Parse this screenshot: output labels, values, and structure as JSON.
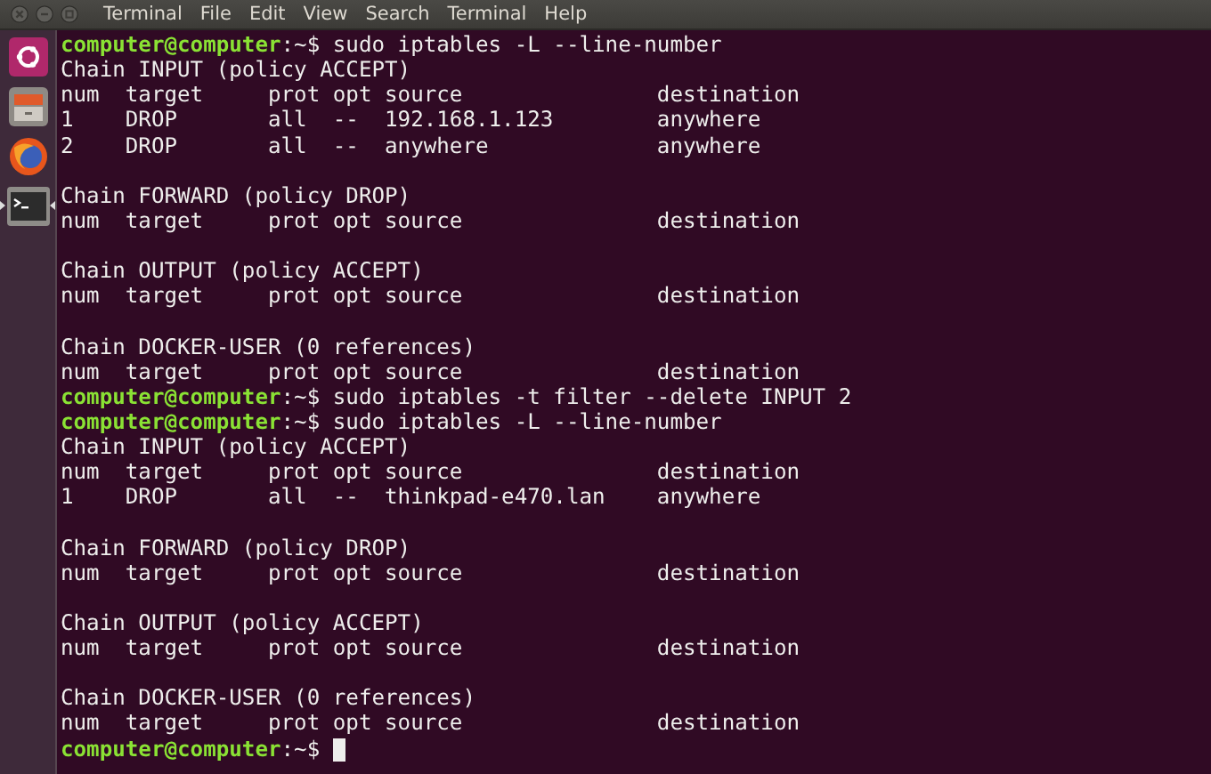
{
  "top_bar": {
    "app_title": "Terminal",
    "menu": [
      "File",
      "Edit",
      "View",
      "Search",
      "Terminal",
      "Help"
    ]
  },
  "dock": [
    {
      "kind": "home",
      "active": false
    },
    {
      "kind": "files",
      "active": false
    },
    {
      "kind": "browser",
      "active": false
    },
    {
      "kind": "terminal",
      "active": true
    }
  ],
  "terminal": {
    "lines": [
      {
        "kind": "prompt",
        "user": "computer@computer",
        "path": ":~$",
        "command": "sudo iptables -L --line-number"
      },
      {
        "kind": "output",
        "text": "Chain INPUT (policy ACCEPT)"
      },
      {
        "kind": "output",
        "text": "num  target     prot opt source               destination"
      },
      {
        "kind": "output",
        "text": "1    DROP       all  --  192.168.1.123        anywhere"
      },
      {
        "kind": "output",
        "text": "2    DROP       all  --  anywhere             anywhere"
      },
      {
        "kind": "blank"
      },
      {
        "kind": "output",
        "text": "Chain FORWARD (policy DROP)"
      },
      {
        "kind": "output",
        "text": "num  target     prot opt source               destination"
      },
      {
        "kind": "blank"
      },
      {
        "kind": "output",
        "text": "Chain OUTPUT (policy ACCEPT)"
      },
      {
        "kind": "output",
        "text": "num  target     prot opt source               destination"
      },
      {
        "kind": "blank"
      },
      {
        "kind": "output",
        "text": "Chain DOCKER-USER (0 references)"
      },
      {
        "kind": "output",
        "text": "num  target     prot opt source               destination"
      },
      {
        "kind": "prompt",
        "user": "computer@computer",
        "path": ":~$",
        "command": "sudo iptables -t filter --delete INPUT 2"
      },
      {
        "kind": "prompt",
        "user": "computer@computer",
        "path": ":~$",
        "command": "sudo iptables -L --line-number"
      },
      {
        "kind": "output",
        "text": "Chain INPUT (policy ACCEPT)"
      },
      {
        "kind": "output",
        "text": "num  target     prot opt source               destination"
      },
      {
        "kind": "output",
        "text": "1    DROP       all  --  thinkpad-e470.lan    anywhere"
      },
      {
        "kind": "blank"
      },
      {
        "kind": "output",
        "text": "Chain FORWARD (policy DROP)"
      },
      {
        "kind": "output",
        "text": "num  target     prot opt source               destination"
      },
      {
        "kind": "blank"
      },
      {
        "kind": "output",
        "text": "Chain OUTPUT (policy ACCEPT)"
      },
      {
        "kind": "output",
        "text": "num  target     prot opt source               destination"
      },
      {
        "kind": "blank"
      },
      {
        "kind": "output",
        "text": "Chain DOCKER-USER (0 references)"
      },
      {
        "kind": "output",
        "text": "num  target     prot opt source               destination"
      },
      {
        "kind": "prompt",
        "user": "computer@computer",
        "path": ":~$",
        "cursor": true
      }
    ]
  }
}
